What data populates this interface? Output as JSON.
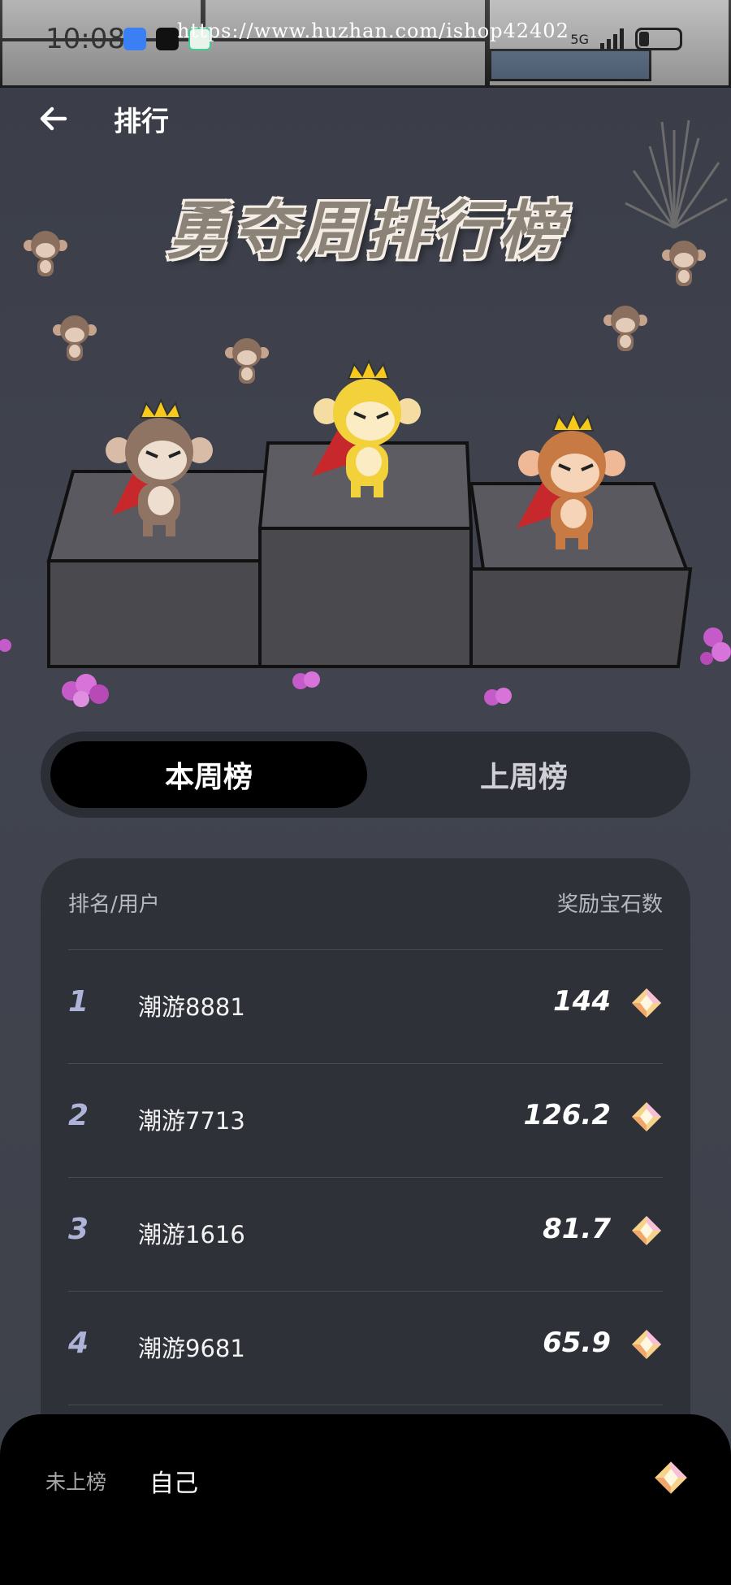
{
  "status_bar": {
    "time": "10:08",
    "watermark": "https://www.huzhan.com/ishop42402",
    "network": "5G"
  },
  "header": {
    "title": "排行",
    "back_icon": "arrow-left-icon"
  },
  "hero": {
    "title": "勇夺周排行榜"
  },
  "tabs": [
    {
      "label": "本周榜",
      "active": true
    },
    {
      "label": "上周榜",
      "active": false
    }
  ],
  "ranking": {
    "col_user": "排名/用户",
    "col_reward": "奖励宝石数",
    "rows": [
      {
        "rank": "1",
        "user": "潮游8881",
        "value": "144"
      },
      {
        "rank": "2",
        "user": "潮游7713",
        "value": "126.2"
      },
      {
        "rank": "3",
        "user": "潮游1616",
        "value": "81.7"
      },
      {
        "rank": "4",
        "user": "潮游9681",
        "value": "65.9"
      }
    ],
    "gem_icon": "gem-icon"
  },
  "self": {
    "status": "未上榜",
    "name": "自己",
    "value": ""
  },
  "colors": {
    "background": "#3e414a",
    "card": "#2f3138",
    "tab_active": "#000000",
    "rank_number": "#aeb3d8"
  }
}
